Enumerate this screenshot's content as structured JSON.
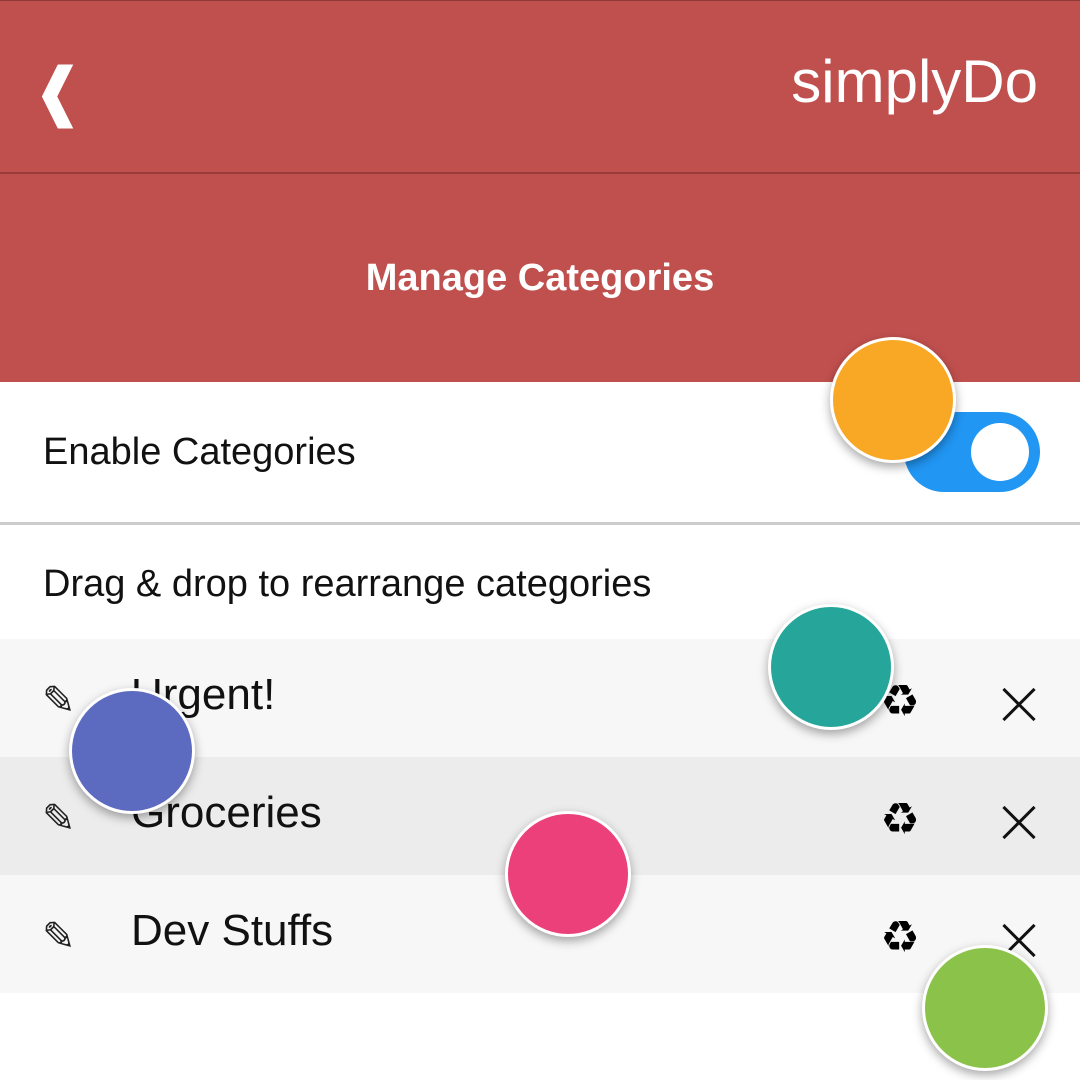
{
  "colors": {
    "appbar": "#c0504e",
    "toggle_on": "#2196f3",
    "row_light": "#f7f7f7",
    "row_dark": "#ececec",
    "touch_markers": [
      "#f9a825",
      "#26a69a",
      "#5c6bc0",
      "#ec407a",
      "#8bc34a"
    ]
  },
  "appbar": {
    "back_icon": "❰",
    "title": "simplyDo"
  },
  "section": {
    "title": "Manage Categories"
  },
  "settings": {
    "enable_label": "Enable Categories",
    "enabled": true
  },
  "hint": "Drag & drop to rearrange categories",
  "categories": [
    {
      "name": "Urgent!",
      "edit_icon": "✎",
      "recycle_icon": "♻"
    },
    {
      "name": "Groceries",
      "edit_icon": "✎",
      "recycle_icon": "♻"
    },
    {
      "name": "Dev Stuffs",
      "edit_icon": "✎",
      "recycle_icon": "♻"
    }
  ]
}
